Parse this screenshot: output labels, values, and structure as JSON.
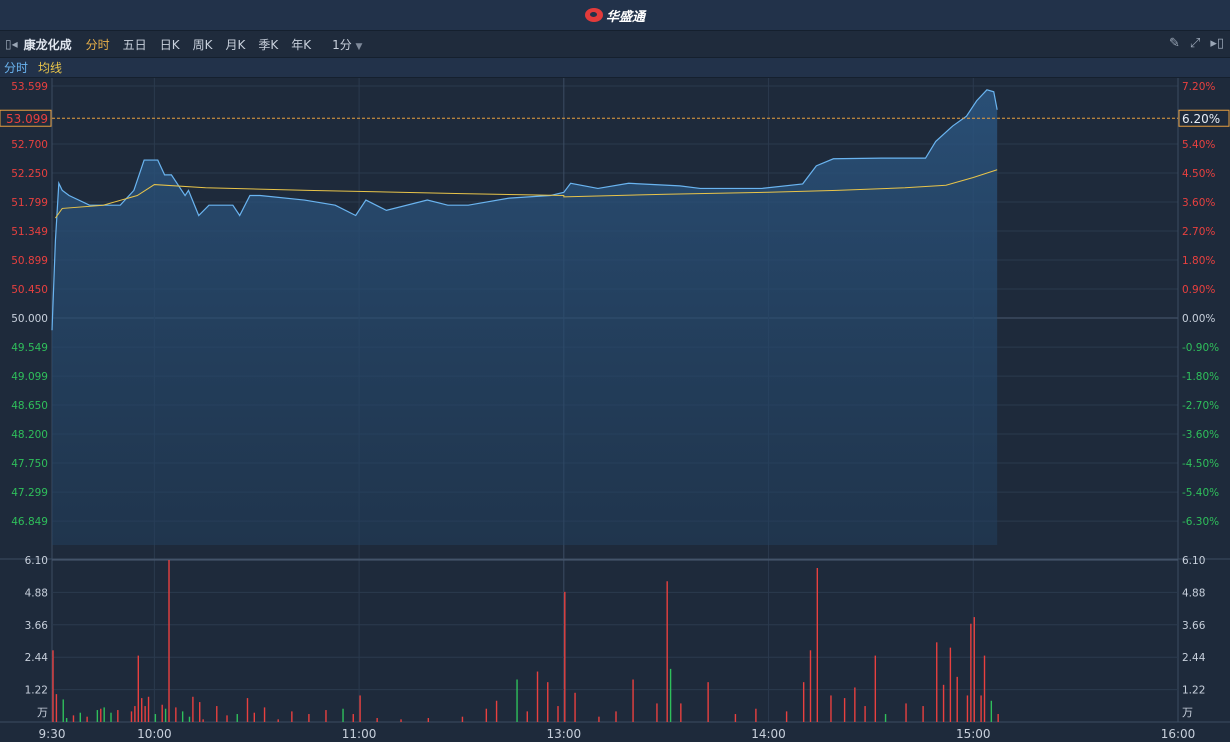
{
  "header": {
    "logo_text": "华盛通"
  },
  "toolbar": {
    "stock_name": "康龙化成",
    "periods": [
      "分时",
      "五日",
      "日K",
      "周K",
      "月K",
      "季K",
      "年K"
    ],
    "active_period": "分时",
    "interval": "1分"
  },
  "legend": {
    "line": "分时",
    "avg": "均线"
  },
  "colors": {
    "up": "#e8403f",
    "down": "#2fbf5b",
    "price_line": "#6ab4f0",
    "avg_line": "#e8c44a",
    "accent": "#e8b04a"
  },
  "chart_data": {
    "type": "line",
    "prev_close": 50.0,
    "price_ticks": [
      "53.599",
      "53.099",
      "52.700",
      "52.250",
      "51.799",
      "51.349",
      "50.899",
      "50.450",
      "50.000",
      "49.549",
      "49.099",
      "48.650",
      "48.200",
      "47.750",
      "47.299",
      "46.849"
    ],
    "pct_ticks": [
      "7.20%",
      "6.20%",
      "5.40%",
      "4.50%",
      "3.60%",
      "2.70%",
      "1.80%",
      "0.90%",
      "0.00%",
      "-0.90%",
      "-1.80%",
      "-2.70%",
      "-3.60%",
      "-4.50%",
      "-5.40%",
      "-6.30%"
    ],
    "current_price": "53.099",
    "current_pct": "6.20%",
    "time_labels": [
      "9:30",
      "10:00",
      "11:00",
      "13:00",
      "14:00",
      "15:00",
      "16:00"
    ],
    "volume_ticks": [
      "6.10",
      "4.88",
      "3.66",
      "2.44",
      "1.22"
    ],
    "volume_unit": "万",
    "volume_max": 6.1,
    "price": [
      [
        "9:30",
        49.81
      ],
      [
        "9:31",
        51.2
      ],
      [
        "9:32",
        52.09
      ],
      [
        "9:33",
        51.98
      ],
      [
        "9:35",
        51.9
      ],
      [
        "9:41",
        51.75
      ],
      [
        "9:50",
        51.75
      ],
      [
        "9:54",
        51.98
      ],
      [
        "9:57",
        52.45
      ],
      [
        "10:01",
        52.45
      ],
      [
        "10:03",
        52.22
      ],
      [
        "10:05",
        52.22
      ],
      [
        "10:09",
        51.9
      ],
      [
        "10:10",
        51.98
      ],
      [
        "10:13",
        51.59
      ],
      [
        "10:16",
        51.75
      ],
      [
        "10:23",
        51.75
      ],
      [
        "10:25",
        51.59
      ],
      [
        "10:28",
        51.9
      ],
      [
        "10:31",
        51.9
      ],
      [
        "10:44",
        51.83
      ],
      [
        "10:53",
        51.75
      ],
      [
        "10:59",
        51.59
      ],
      [
        "11:02",
        51.83
      ],
      [
        "11:08",
        51.67
      ],
      [
        "11:20",
        51.83
      ],
      [
        "11:26",
        51.75
      ],
      [
        "11:32",
        51.75
      ],
      [
        "11:44",
        51.86
      ],
      [
        "11:56",
        51.9
      ],
      [
        "12:00",
        51.95
      ],
      [
        "13:02",
        52.09
      ],
      [
        "13:10",
        52.01
      ],
      [
        "13:19",
        52.09
      ],
      [
        "13:34",
        52.05
      ],
      [
        "13:40",
        52.01
      ],
      [
        "13:58",
        52.01
      ],
      [
        "14:10",
        52.08
      ],
      [
        "14:14",
        52.36
      ],
      [
        "14:19",
        52.47
      ],
      [
        "14:33",
        52.48
      ],
      [
        "14:46",
        52.48
      ],
      [
        "14:49",
        52.74
      ],
      [
        "14:54",
        52.98
      ],
      [
        "14:58",
        53.13
      ],
      [
        "15:01",
        53.37
      ],
      [
        "15:04",
        53.54
      ],
      [
        "15:06",
        53.51
      ],
      [
        "15:07",
        53.23
      ]
    ],
    "avg": [
      [
        "9:31",
        51.55
      ],
      [
        "9:33",
        51.7
      ],
      [
        "9:45",
        51.75
      ],
      [
        "9:55",
        51.9
      ],
      [
        "10:00",
        52.07
      ],
      [
        "10:15",
        52.02
      ],
      [
        "10:45",
        51.98
      ],
      [
        "11:30",
        51.93
      ],
      [
        "12:00",
        51.9
      ],
      [
        "13:00",
        51.88
      ],
      [
        "13:30",
        51.92
      ],
      [
        "14:00",
        51.95
      ],
      [
        "14:20",
        51.98
      ],
      [
        "14:40",
        52.02
      ],
      [
        "14:52",
        52.06
      ],
      [
        "15:00",
        52.18
      ],
      [
        "15:07",
        52.3
      ]
    ],
    "volume": [
      [
        "9:30",
        2.7,
        "r"
      ],
      [
        "9:31",
        1.05,
        "r"
      ],
      [
        "9:33",
        0.85,
        "g"
      ],
      [
        "9:34",
        0.15,
        "g"
      ],
      [
        "9:36",
        0.25,
        "r"
      ],
      [
        "9:38",
        0.35,
        "g"
      ],
      [
        "9:40",
        0.2,
        "r"
      ],
      [
        "9:43",
        0.45,
        "g"
      ],
      [
        "9:44",
        0.5,
        "r"
      ],
      [
        "9:45",
        0.55,
        "g"
      ],
      [
        "9:47",
        0.35,
        "g"
      ],
      [
        "9:49",
        0.45,
        "r"
      ],
      [
        "9:53",
        0.4,
        "r"
      ],
      [
        "9:54",
        0.6,
        "r"
      ],
      [
        "9:55",
        2.5,
        "r"
      ],
      [
        "9:56",
        0.9,
        "r"
      ],
      [
        "9:57",
        0.6,
        "r"
      ],
      [
        "9:58",
        0.95,
        "r"
      ],
      [
        "10:00",
        0.3,
        "g"
      ],
      [
        "10:02",
        0.65,
        "r"
      ],
      [
        "10:03",
        0.5,
        "g"
      ],
      [
        "10:04",
        6.1,
        "r"
      ],
      [
        "10:06",
        0.55,
        "r"
      ],
      [
        "10:08",
        0.4,
        "g"
      ],
      [
        "10:10",
        0.2,
        "g"
      ],
      [
        "10:11",
        0.95,
        "r"
      ],
      [
        "10:13",
        0.75,
        "r"
      ],
      [
        "10:14",
        0.1,
        "r"
      ],
      [
        "10:18",
        0.6,
        "r"
      ],
      [
        "10:21",
        0.25,
        "r"
      ],
      [
        "10:24",
        0.3,
        "g"
      ],
      [
        "10:27",
        0.9,
        "r"
      ],
      [
        "10:29",
        0.35,
        "r"
      ],
      [
        "10:32",
        0.55,
        "r"
      ],
      [
        "10:36",
        0.1,
        "r"
      ],
      [
        "10:40",
        0.4,
        "r"
      ],
      [
        "10:45",
        0.3,
        "r"
      ],
      [
        "10:50",
        0.45,
        "r"
      ],
      [
        "10:55",
        0.5,
        "g"
      ],
      [
        "10:58",
        0.3,
        "r"
      ],
      [
        "11:00",
        1.0,
        "r"
      ],
      [
        "11:05",
        0.15,
        "r"
      ],
      [
        "11:12",
        0.1,
        "r"
      ],
      [
        "11:20",
        0.15,
        "r"
      ],
      [
        "11:30",
        0.2,
        "r"
      ],
      [
        "11:37",
        0.5,
        "r"
      ],
      [
        "11:40",
        0.8,
        "r"
      ],
      [
        "11:46",
        1.6,
        "g"
      ],
      [
        "11:49",
        0.4,
        "r"
      ],
      [
        "11:52",
        1.9,
        "r"
      ],
      [
        "11:55",
        1.5,
        "r"
      ],
      [
        "11:58",
        0.6,
        "r"
      ],
      [
        "13:00",
        4.9,
        "r"
      ],
      [
        "13:03",
        1.1,
        "r"
      ],
      [
        "13:10",
        0.2,
        "r"
      ],
      [
        "13:15",
        0.4,
        "r"
      ],
      [
        "13:20",
        1.6,
        "r"
      ],
      [
        "13:27",
        0.7,
        "r"
      ],
      [
        "13:30",
        5.3,
        "r"
      ],
      [
        "13:31",
        2.0,
        "g"
      ],
      [
        "13:34",
        0.7,
        "r"
      ],
      [
        "13:42",
        1.5,
        "r"
      ],
      [
        "13:50",
        0.3,
        "r"
      ],
      [
        "13:56",
        0.5,
        "r"
      ],
      [
        "14:05",
        0.4,
        "r"
      ],
      [
        "14:10",
        1.5,
        "r"
      ],
      [
        "14:12",
        2.7,
        "r"
      ],
      [
        "14:14",
        5.8,
        "r"
      ],
      [
        "14:18",
        1.0,
        "r"
      ],
      [
        "14:22",
        0.9,
        "r"
      ],
      [
        "14:25",
        1.3,
        "r"
      ],
      [
        "14:28",
        0.6,
        "r"
      ],
      [
        "14:31",
        2.5,
        "r"
      ],
      [
        "14:34",
        0.3,
        "g"
      ],
      [
        "14:40",
        0.7,
        "r"
      ],
      [
        "14:45",
        0.6,
        "r"
      ],
      [
        "14:49",
        3.0,
        "r"
      ],
      [
        "14:51",
        1.4,
        "r"
      ],
      [
        "14:53",
        2.8,
        "r"
      ],
      [
        "14:55",
        1.7,
        "r"
      ],
      [
        "14:58",
        1.0,
        "r"
      ],
      [
        "14:59",
        3.7,
        "r"
      ],
      [
        "15:00",
        3.95,
        "r"
      ],
      [
        "15:02",
        1.0,
        "r"
      ],
      [
        "15:03",
        2.5,
        "r"
      ],
      [
        "15:05",
        0.8,
        "g"
      ],
      [
        "15:07",
        0.3,
        "r"
      ]
    ]
  }
}
